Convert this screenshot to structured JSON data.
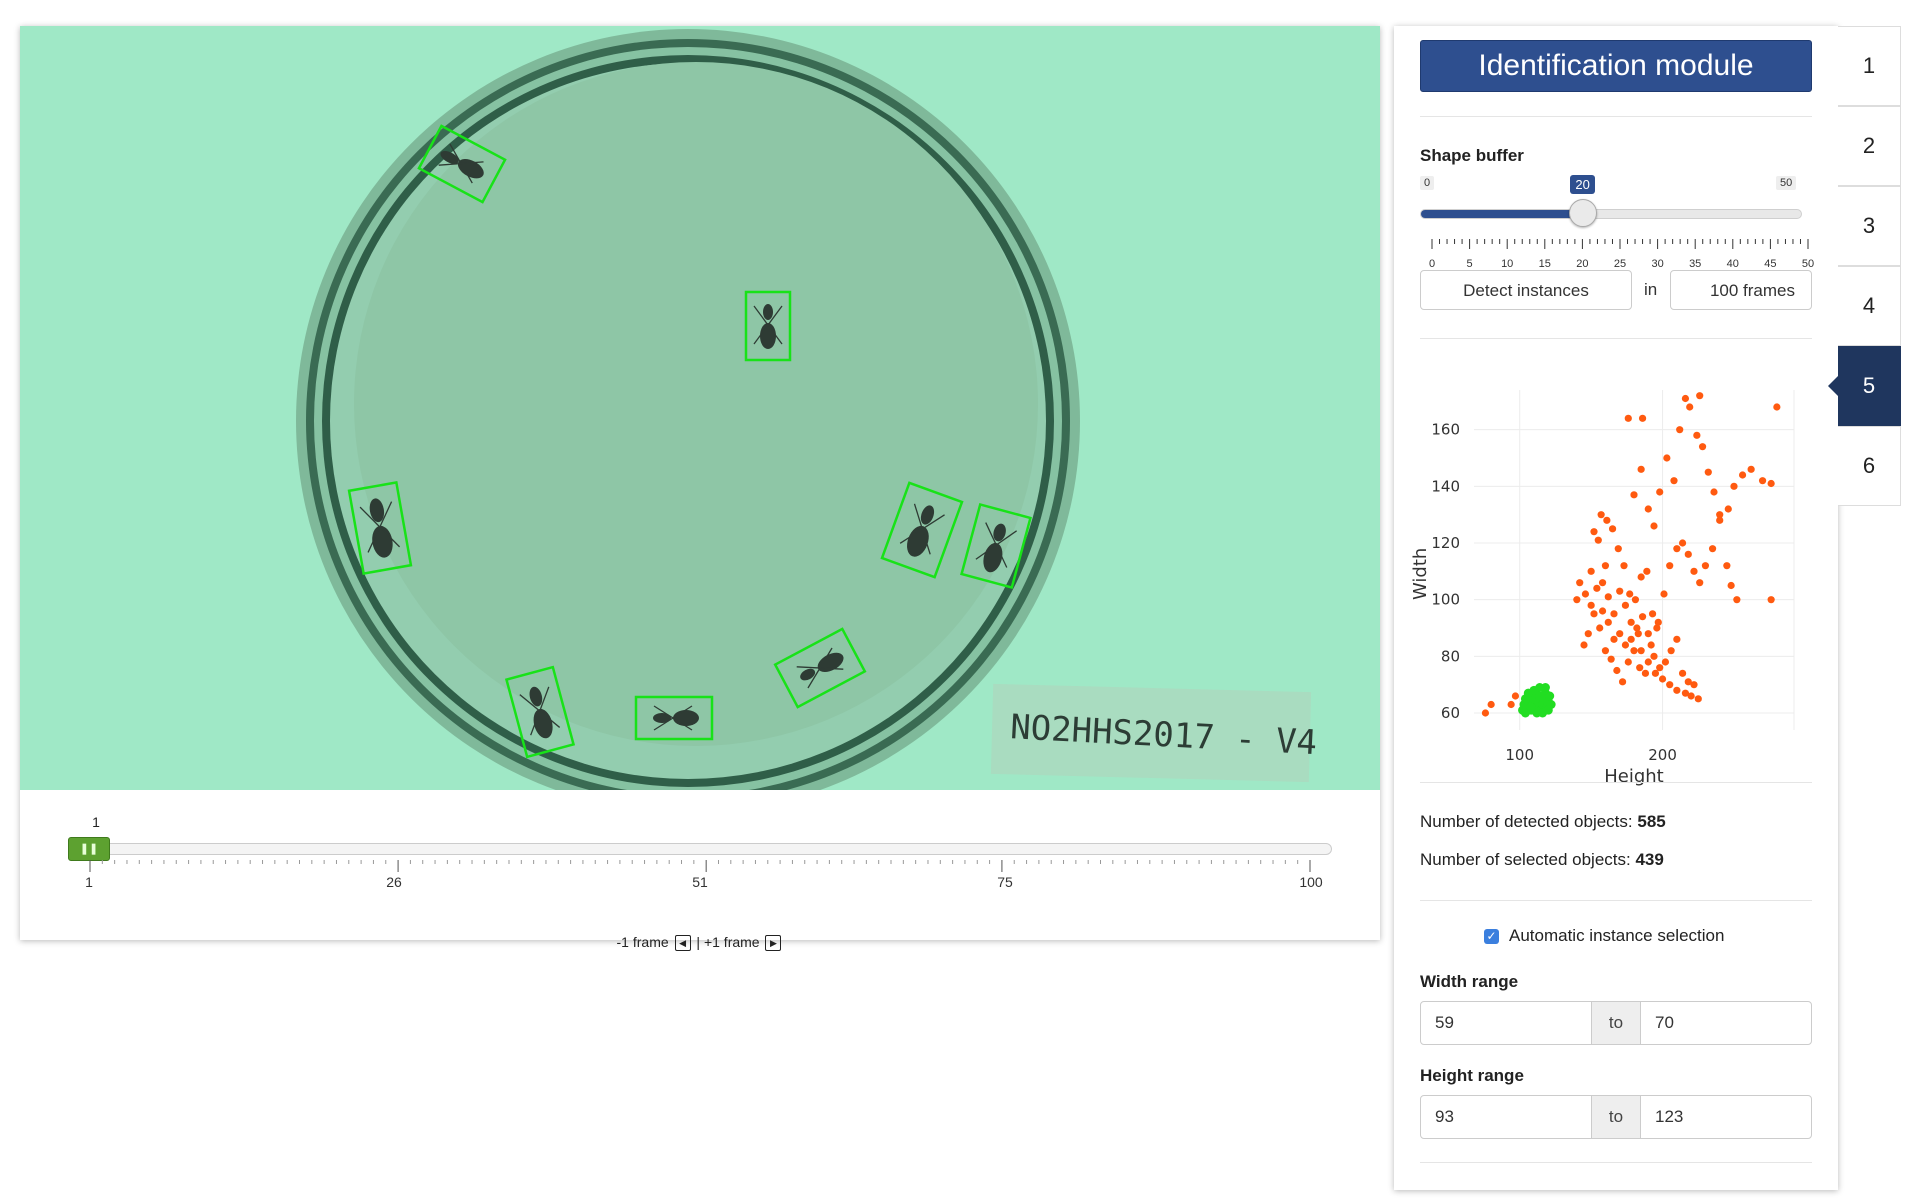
{
  "video": {
    "label_text": "NO2HHS2017 - V4"
  },
  "frame_slider": {
    "current": "1",
    "ticks": [
      "1",
      "26",
      "51",
      "75",
      "100"
    ],
    "handle_icon": "pause-icon",
    "prev_label": "-1 frame",
    "separator": "|",
    "next_label": "+1 frame"
  },
  "module": {
    "title": "Identification module"
  },
  "shape_buffer": {
    "label": "Shape buffer",
    "min": "0",
    "max": "50",
    "value": "20",
    "value_number": 20,
    "tick_labels": [
      "0",
      "5",
      "10",
      "15",
      "20",
      "25",
      "30",
      "35",
      "40",
      "45",
      "50"
    ]
  },
  "detect": {
    "button_label": "Detect instances",
    "in_label": "in",
    "frames_value": "100 frames"
  },
  "chart_data": {
    "type": "scatter",
    "xlabel": "Height",
    "ylabel": "Width",
    "x_ticks": [
      "100",
      "200"
    ],
    "y_ticks": [
      "60",
      "80",
      "100",
      "120",
      "140",
      "160"
    ],
    "xlim": [
      68,
      292
    ],
    "ylim": [
      54,
      174
    ],
    "colors": {
      "detected": "#ff5a10",
      "selected": "#22dd22"
    },
    "series": [
      {
        "color": "#ff5a10",
        "points": [
          [
            76,
            60
          ],
          [
            80,
            63
          ],
          [
            94,
            63
          ],
          [
            97,
            66
          ],
          [
            150,
            110
          ],
          [
            155,
            121
          ],
          [
            158,
            106
          ],
          [
            160,
            112
          ],
          [
            162,
            101
          ],
          [
            166,
            95
          ],
          [
            170,
            103
          ],
          [
            174,
            98
          ],
          [
            178,
            92
          ],
          [
            183,
            88
          ],
          [
            185,
            82
          ],
          [
            190,
            78
          ],
          [
            195,
            74
          ],
          [
            200,
            72
          ],
          [
            205,
            70
          ],
          [
            210,
            68
          ],
          [
            216,
            67
          ],
          [
            220,
            66
          ],
          [
            225,
            65
          ],
          [
            145,
            84
          ],
          [
            148,
            88
          ],
          [
            152,
            95
          ],
          [
            156,
            90
          ],
          [
            160,
            82
          ],
          [
            164,
            79
          ],
          [
            168,
            75
          ],
          [
            172,
            71
          ],
          [
            176,
            78
          ],
          [
            180,
            82
          ],
          [
            184,
            76
          ],
          [
            188,
            74
          ],
          [
            192,
            84
          ],
          [
            196,
            90
          ],
          [
            152,
            124
          ],
          [
            157,
            130
          ],
          [
            161,
            128
          ],
          [
            165,
            125
          ],
          [
            169,
            118
          ],
          [
            173,
            112
          ],
          [
            177,
            102
          ],
          [
            181,
            100
          ],
          [
            185,
            108
          ],
          [
            189,
            110
          ],
          [
            193,
            95
          ],
          [
            197,
            92
          ],
          [
            201,
            102
          ],
          [
            205,
            112
          ],
          [
            210,
            118
          ],
          [
            214,
            120
          ],
          [
            218,
            116
          ],
          [
            222,
            110
          ],
          [
            226,
            106
          ],
          [
            230,
            112
          ],
          [
            235,
            118
          ],
          [
            240,
            128
          ],
          [
            246,
            132
          ],
          [
            250,
            140
          ],
          [
            256,
            144
          ],
          [
            262,
            146
          ],
          [
            270,
            142
          ],
          [
            276,
            141
          ],
          [
            276,
            100
          ],
          [
            280,
            168
          ],
          [
            180,
            137
          ],
          [
            185,
            146
          ],
          [
            190,
            132
          ],
          [
            194,
            126
          ],
          [
            198,
            138
          ],
          [
            203,
            150
          ],
          [
            208,
            142
          ],
          [
            212,
            160
          ],
          [
            219,
            168
          ],
          [
            224,
            158
          ],
          [
            228,
            154
          ],
          [
            232,
            145
          ],
          [
            236,
            138
          ],
          [
            240,
            130
          ],
          [
            245,
            112
          ],
          [
            248,
            105
          ],
          [
            252,
            100
          ],
          [
            176,
            164
          ],
          [
            186,
            164
          ],
          [
            216,
            171
          ],
          [
            226,
            172
          ],
          [
            140,
            100
          ],
          [
            142,
            106
          ],
          [
            146,
            102
          ],
          [
            150,
            98
          ],
          [
            154,
            104
          ],
          [
            158,
            96
          ],
          [
            162,
            92
          ],
          [
            166,
            86
          ],
          [
            170,
            88
          ],
          [
            174,
            84
          ],
          [
            178,
            86
          ],
          [
            182,
            90
          ],
          [
            186,
            94
          ],
          [
            190,
            88
          ],
          [
            194,
            80
          ],
          [
            198,
            76
          ],
          [
            202,
            78
          ],
          [
            206,
            82
          ],
          [
            210,
            86
          ],
          [
            214,
            74
          ],
          [
            218,
            71
          ],
          [
            222,
            70
          ]
        ]
      },
      {
        "color": "#22dd22",
        "points": [
          [
            102,
            61
          ],
          [
            103,
            63
          ],
          [
            104,
            65
          ],
          [
            105,
            62
          ],
          [
            106,
            64
          ],
          [
            107,
            66
          ],
          [
            108,
            61
          ],
          [
            109,
            63
          ],
          [
            110,
            65
          ],
          [
            111,
            67
          ],
          [
            112,
            62
          ],
          [
            113,
            64
          ],
          [
            114,
            66
          ],
          [
            115,
            61
          ],
          [
            116,
            63
          ],
          [
            117,
            65
          ],
          [
            118,
            67
          ],
          [
            119,
            62
          ],
          [
            120,
            64
          ],
          [
            121,
            66
          ],
          [
            122,
            63
          ],
          [
            104,
            60
          ],
          [
            108,
            62
          ],
          [
            112,
            60
          ],
          [
            116,
            60
          ],
          [
            120,
            61
          ],
          [
            110,
            68
          ],
          [
            114,
            69
          ],
          [
            118,
            69
          ],
          [
            106,
            67
          ]
        ]
      }
    ]
  },
  "stats": {
    "detected_label": "Number of detected objects:",
    "detected_value": "585",
    "selected_label": "Number of selected objects:",
    "selected_value": "439"
  },
  "auto_select": {
    "label": "Automatic instance selection",
    "checked": true
  },
  "width_range": {
    "label": "Width range",
    "min": "59",
    "to_label": "to",
    "max": "70"
  },
  "height_range": {
    "label": "Height range",
    "min": "93",
    "to_label": "to",
    "max": "123"
  },
  "tabs": [
    "1",
    "2",
    "3",
    "4",
    "5",
    "6"
  ],
  "active_tab": "5"
}
